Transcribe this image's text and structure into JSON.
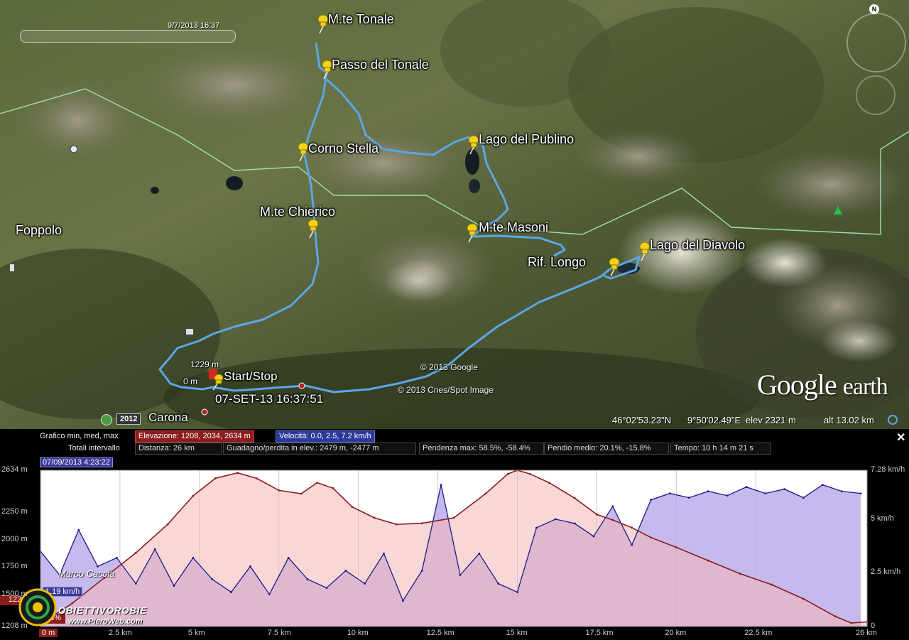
{
  "map": {
    "time_slider_label": "9/7/2013  16:37",
    "waypoints": [
      {
        "label": "M.te Tonale"
      },
      {
        "label": "Passo del Tonale"
      },
      {
        "label": "Corno Stella"
      },
      {
        "label": "Lago del Publino"
      },
      {
        "label": "M.te Chierico"
      },
      {
        "label": "M.te Masoni"
      },
      {
        "label": "Lago del Diavolo"
      },
      {
        "label": "Rif. Longo"
      }
    ],
    "places": {
      "foppolo": "Foppolo",
      "carona": "Carona"
    },
    "start": {
      "label": "Start/Stop",
      "elev_label": "1229 m",
      "zero_label": "0 m",
      "timestamp": "07-SET-13 16:37:51"
    },
    "copyrights": [
      "© 2013 Google",
      "© 2013 Cnes/Spot Image"
    ],
    "logo": {
      "google": "Google",
      "earth": "earth"
    },
    "north_label": "N",
    "status": {
      "lat": "46°02'53.23\"N",
      "lon": "9°50'02.49\"E",
      "elev": "elev  2321 m",
      "alt": "alt  13.02 km"
    },
    "historical_year": "2012",
    "colors": {
      "route": "#5aa7e8",
      "pin": "#f3d21b",
      "start_pin": "#e02020",
      "border": "#9fe0b5"
    }
  },
  "profile": {
    "graph_label": "Grafico  min, med, max",
    "elevation_stat": "Elevazione: 1208, 2034, 2634 m",
    "speed_stat": "Velocità: 0.0, 2.5, 7.2 km/h",
    "totals_label": "Totali intervallo",
    "distance": "Distanza: 26 km",
    "gain_loss": "Guadagno/perdita in elev.: 2479 m, -2477 m",
    "max_slope": "Pendenza max: 58.5%, -58.4%",
    "avg_slope": "Pendio medio: 20.1%, -15.8%",
    "time": "Tempo: 10 h 14 m 21 s",
    "cursor_date": "07/09/2013 4:23:22",
    "cursor_speed": "1.19 km/h",
    "left_stub_1": "122",
    "left_stub_2": "13%",
    "close": "✕",
    "author": "Marco Caccia",
    "logo_text": "OBIETTIVOROBIE",
    "logo_url": "www.PieroWeb.com",
    "start_km_label": "0 m",
    "y_left_ticks": [
      "2634 m",
      "2250 m",
      "2000 m",
      "1750 m",
      "1500 m",
      "1208 m"
    ],
    "y_right_ticks": [
      "7.28 km/h",
      "5 km/h",
      "2.5 km/h",
      "0"
    ],
    "x_ticks": [
      "2.5 km",
      "5 km",
      "7.5 km",
      "10 km",
      "12.5 km",
      "15 km",
      "17.5 km",
      "20 km",
      "22.5 km",
      "26 km"
    ]
  },
  "chart_data": {
    "type": "area",
    "title": "",
    "xlabel": "",
    "ylabel": "",
    "xlim": [
      0,
      26
    ],
    "ylim_left": [
      1208,
      2634
    ],
    "ylim_right": [
      0,
      7.28
    ],
    "series": [
      {
        "name": "Elevazione",
        "unit": "m",
        "axis": "left",
        "color": "#8b1d1d",
        "x": [
          0,
          1,
          2,
          3,
          4,
          4.8,
          5.5,
          6.2,
          6.8,
          7.5,
          8.2,
          8.7,
          9.2,
          9.8,
          10.5,
          11.2,
          12,
          13,
          14,
          14.7,
          15,
          15.4,
          16,
          16.8,
          17.5,
          18,
          18.6,
          19.2,
          20,
          21,
          22,
          23,
          24,
          25,
          25.5,
          26
        ],
        "y": [
          1229,
          1420,
          1650,
          1880,
          2140,
          2400,
          2560,
          2610,
          2560,
          2450,
          2420,
          2520,
          2470,
          2300,
          2200,
          2140,
          2150,
          2200,
          2420,
          2600,
          2634,
          2600,
          2520,
          2380,
          2230,
          2180,
          2110,
          2020,
          1930,
          1810,
          1690,
          1590,
          1460,
          1300,
          1240,
          1250
        ]
      },
      {
        "name": "Velocità",
        "unit": "km/h",
        "axis": "right",
        "color": "#1a1a8a",
        "x": [
          0,
          0.6,
          1.2,
          1.8,
          2.4,
          3,
          3.6,
          4.2,
          4.8,
          5.4,
          6,
          6.6,
          7.2,
          7.8,
          8.4,
          9,
          9.6,
          10.2,
          10.8,
          11.4,
          12,
          12.6,
          13.2,
          13.8,
          14.4,
          15,
          15.6,
          16.2,
          16.8,
          17.4,
          18,
          18.6,
          19.2,
          19.8,
          20.4,
          21,
          21.6,
          22.2,
          22.8,
          23.4,
          24,
          24.6,
          25.2,
          25.8
        ],
        "y": [
          3.5,
          2.4,
          4.5,
          2.8,
          3.2,
          2.0,
          3.6,
          1.9,
          3.2,
          2.2,
          1.6,
          2.8,
          1.5,
          3.2,
          2.2,
          1.8,
          2.6,
          2.0,
          3.4,
          1.2,
          2.6,
          6.6,
          2.4,
          3.4,
          2.0,
          1.6,
          4.6,
          5.0,
          4.8,
          4.2,
          5.6,
          3.8,
          5.9,
          6.2,
          6.0,
          6.3,
          6.1,
          6.5,
          6.2,
          6.4,
          6.0,
          6.6,
          6.3,
          6.2
        ]
      }
    ]
  }
}
